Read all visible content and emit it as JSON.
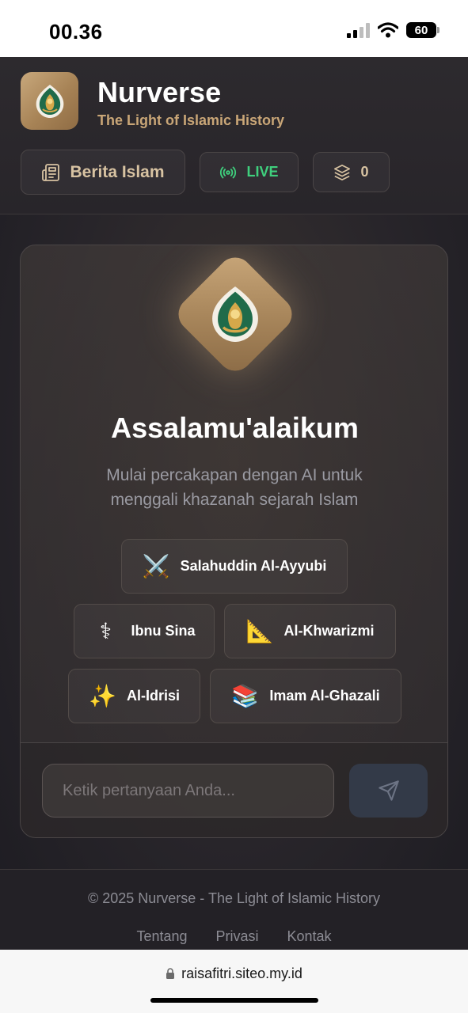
{
  "status_bar": {
    "time": "00.36",
    "battery": "60"
  },
  "header": {
    "app_name": "Nurverse",
    "tagline": "The Light of Islamic History",
    "news_button": "Berita Islam",
    "live_label": "LIVE",
    "layers_count": "0"
  },
  "main": {
    "greeting": "Assalamu'alaikum",
    "intro": "Mulai percakapan dengan AI untuk menggali khazanah sejarah Islam",
    "figures": [
      {
        "label": "Salahuddin Al-Ayyubi",
        "icon": "⚔️"
      },
      {
        "label": "Ibnu Sina",
        "icon": "⚕"
      },
      {
        "label": "Al-Khwarizmi",
        "icon": "📐"
      },
      {
        "label": "Al-Idrisi",
        "icon": "✨"
      },
      {
        "label": "Imam Al-Ghazali",
        "icon": "📚"
      }
    ],
    "input_placeholder": "Ketik pertanyaan Anda..."
  },
  "footer": {
    "copyright": "© 2025 Nurverse - The Light of Islamic History",
    "links": [
      "Tentang",
      "Privasi",
      "Kontak"
    ]
  },
  "browser": {
    "url": "raisafitri.siteo.my.id"
  },
  "colors": {
    "accent_gold": "#c9a677",
    "live_green": "#3fcf7d",
    "emblem_green": "#1f6b4a"
  }
}
